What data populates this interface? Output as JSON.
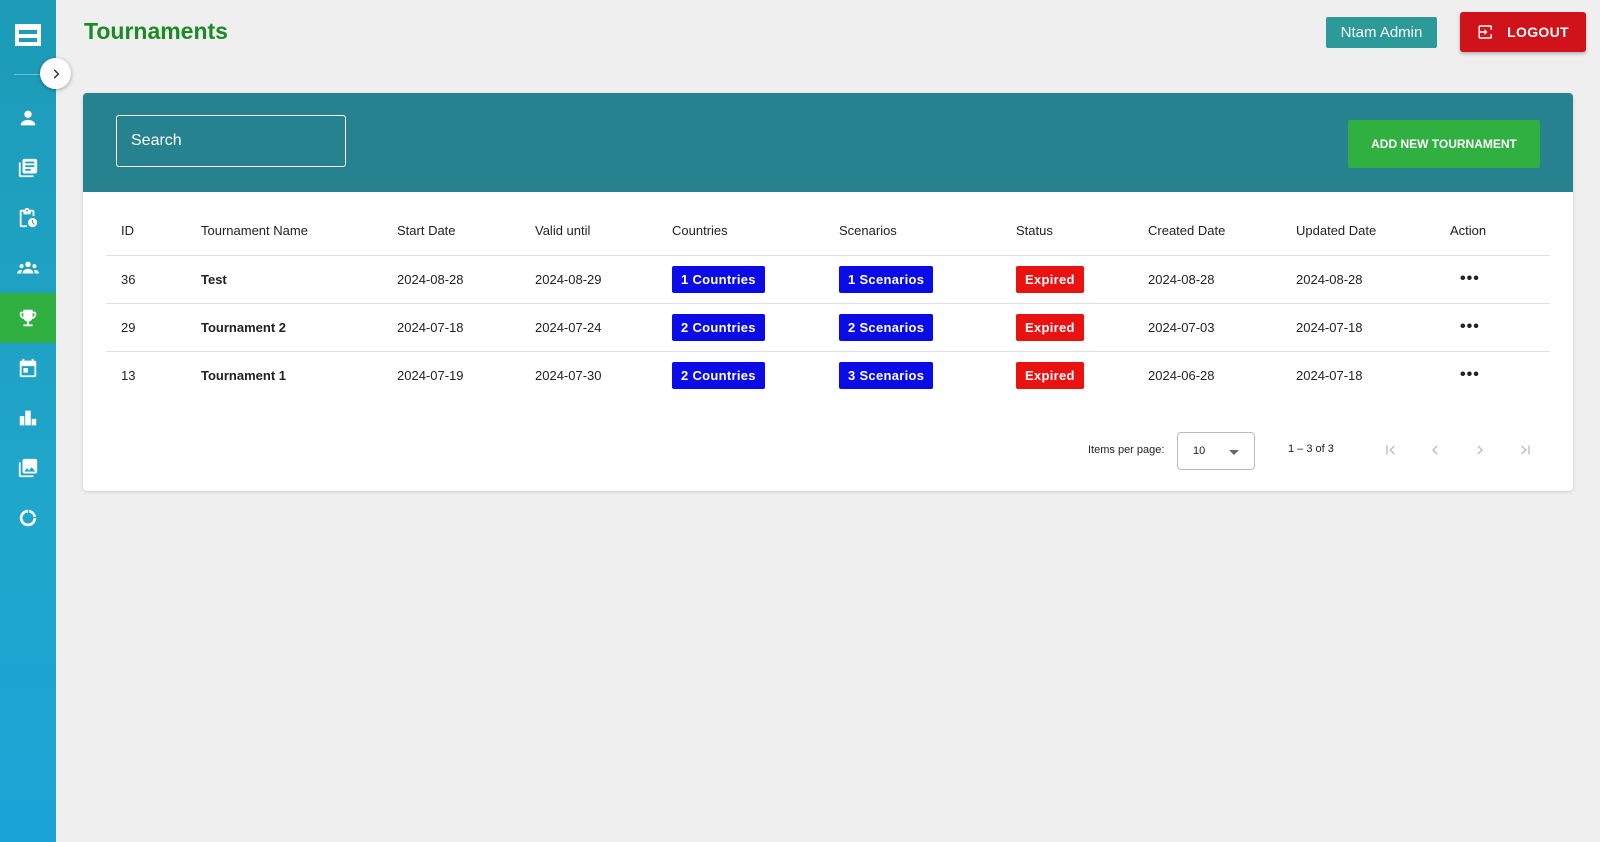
{
  "header": {
    "title": "Tournaments",
    "user_label": "Ntam Admin",
    "logout_label": "LOGOUT"
  },
  "sidebar": {
    "items": [
      {
        "icon": "person-icon",
        "active": false
      },
      {
        "icon": "library-books-icon",
        "active": false
      },
      {
        "icon": "clipboard-clock-icon",
        "active": false
      },
      {
        "icon": "groups-icon",
        "active": false
      },
      {
        "icon": "trophy-icon",
        "active": true
      },
      {
        "icon": "calendar-icon",
        "active": false
      },
      {
        "icon": "bar-chart-icon",
        "active": false
      },
      {
        "icon": "photo-library-icon",
        "active": false
      },
      {
        "icon": "loading-circle-icon",
        "active": false
      }
    ]
  },
  "toolbar": {
    "search_placeholder": "Search",
    "add_button_label": "ADD NEW TOURNAMENT"
  },
  "table": {
    "columns": [
      "ID",
      "Tournament Name",
      "Start Date",
      "Valid until",
      "Countries",
      "Scenarios",
      "Status",
      "Created Date",
      "Updated Date",
      "Action"
    ],
    "rows": [
      {
        "id": "36",
        "name": "Test",
        "start": "2024-08-28",
        "valid": "2024-08-29",
        "countries": "1 Countries",
        "scenarios": "1 Scenarios",
        "status": "Expired",
        "created": "2024-08-28",
        "updated": "2024-08-28",
        "action": "•••"
      },
      {
        "id": "29",
        "name": "Tournament 2",
        "start": "2024-07-18",
        "valid": "2024-07-24",
        "countries": "2 Countries",
        "scenarios": "2 Scenarios",
        "status": "Expired",
        "created": "2024-07-03",
        "updated": "2024-07-18",
        "action": "•••"
      },
      {
        "id": "13",
        "name": "Tournament 1",
        "start": "2024-07-19",
        "valid": "2024-07-30",
        "countries": "2 Countries",
        "scenarios": "3 Scenarios",
        "status": "Expired",
        "created": "2024-06-28",
        "updated": "2024-07-18",
        "action": "•••"
      }
    ]
  },
  "paginator": {
    "items_per_page_label": "Items per page:",
    "items_per_page_value": "10",
    "range_label": "1 – 3 of 3"
  },
  "colors": {
    "accent_teal": "#26828f",
    "primary_green": "#2fb040",
    "danger_red": "#d0121a",
    "chip_blue": "#0b0be8",
    "title_green": "#1b8a25"
  }
}
